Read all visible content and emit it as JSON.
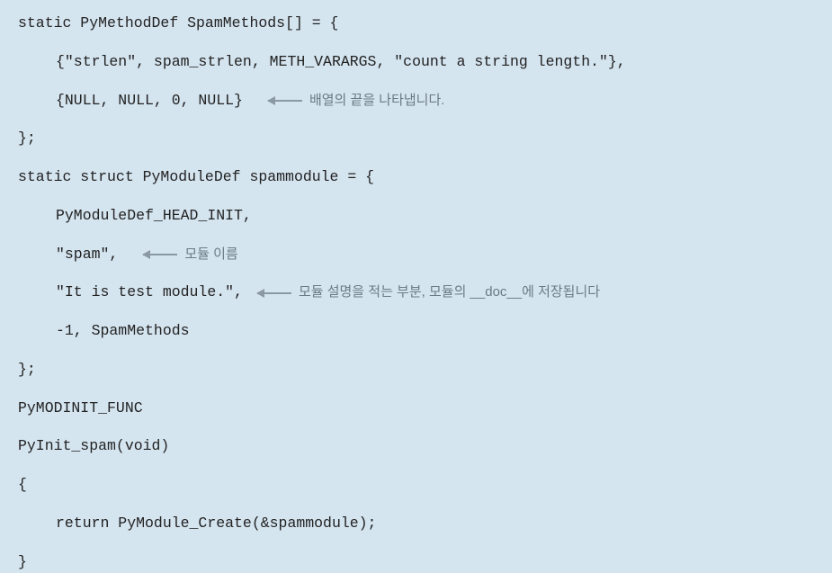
{
  "code": {
    "line1": "static PyMethodDef SpamMethods[] = {",
    "line2": "{\"strlen\", spam_strlen, METH_VARARGS, \"count a string length.\"},",
    "line3": "{NULL, NULL, 0, NULL}",
    "line4": "};",
    "line5": "static struct PyModuleDef spammodule = {",
    "line6": "PyModuleDef_HEAD_INIT,",
    "line7": "\"spam\",",
    "line8": "\"It is test module.\",",
    "line9": "-1, SpamMethods",
    "line10": "};",
    "line11": "PyMODINIT_FUNC",
    "line12": "PyInit_spam(void)",
    "line13": "{",
    "line14": "return PyModule_Create(&spammodule);",
    "line15": "}"
  },
  "annotations": {
    "a1": "배열의 끝을 나타냅니다.",
    "a2": "모듈 이름",
    "a3": "모듈 설명을 적는 부분, 모듈의  __doc__에 저장됩니다"
  }
}
